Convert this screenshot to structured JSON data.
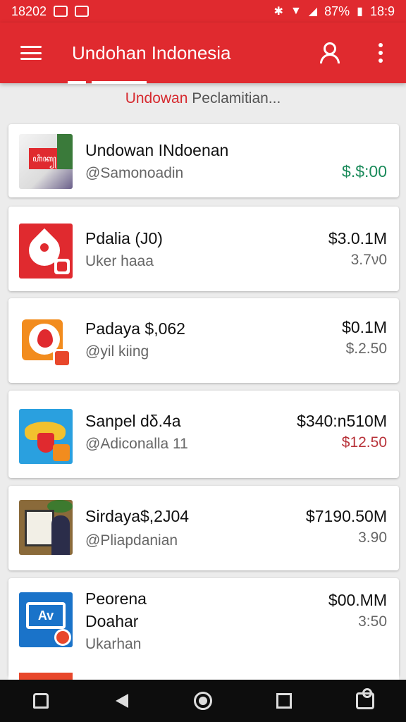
{
  "status_bar": {
    "left_time": "18202",
    "battery": "87%",
    "right_time": "18:9"
  },
  "app_bar": {
    "title": "Undohan Indonesia"
  },
  "subtitle": {
    "accent": "Undowan",
    "rest": " Peclamitian..."
  },
  "items": [
    {
      "title": "Undowan INdoenan",
      "subtitle": "@Samonoadin",
      "subtitle2": "",
      "price": "",
      "change": "$.$:00",
      "change_color": "#1a8a5a"
    },
    {
      "title": "Pdalia (J0)",
      "subtitle": "Uker haaa",
      "subtitle2": "",
      "price": "$3.0.1M",
      "change": "3.7ν0",
      "change_color": "#666666"
    },
    {
      "title": "Padaya $,062",
      "subtitle": "@yil kiing",
      "subtitle2": "",
      "price": "$0.1M",
      "change": "$.2.50",
      "change_color": "#666666"
    },
    {
      "title": "Sanpel dδ.4a",
      "subtitle": "@Adiconalla  11",
      "subtitle2": "",
      "price": "$340:n510M",
      "change": "$12.50",
      "change_color": "#b8333a"
    },
    {
      "title": "Sirdaya$,2J04",
      "subtitle": "@Pliapdanian",
      "subtitle2": "",
      "price": "$7190.50M",
      "change": "3.90",
      "change_color": "#666666"
    },
    {
      "title": "Peorena",
      "subtitle": "Doahar",
      "subtitle2": "Ukarhan",
      "price": "$00.MM",
      "change": "3:50",
      "change_color": "#666666"
    }
  ],
  "icons": {
    "menu": "hamburger-menu-icon",
    "account": "person-icon",
    "more": "more-vert-icon"
  },
  "colors": {
    "brand": "#e02a2f",
    "positive": "#1a8a5a",
    "negative": "#b8333a"
  }
}
